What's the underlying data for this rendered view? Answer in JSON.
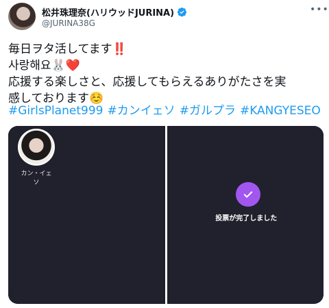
{
  "author": {
    "display_name": "松井珠理奈(ハリウッドJURINA)",
    "handle": "@JURINA38G",
    "verified_icon": "verified-badge-icon",
    "more_icon": "more-horizontal-icon"
  },
  "tweet": {
    "lines": [
      "毎日ヲタ活してます‼️",
      "사랑해요🐰❤️",
      "応援する楽しさと、応援してもらえるありがたさを実",
      "感しております☺️"
    ],
    "hashtags": [
      "#GirlsPlanet999",
      "#カンイェソ",
      "#ガルプラ",
      "#KANGYESEO"
    ]
  },
  "media": {
    "trainee_name": "カン・イェソ",
    "vote_complete_text": "投票が完了しました",
    "check_icon": "check-circle-icon"
  },
  "colors": {
    "link": "#1d9bf0",
    "verified": "#1d9bf0",
    "vote_accent": "#a256f0",
    "media_bg": "#21212d"
  }
}
